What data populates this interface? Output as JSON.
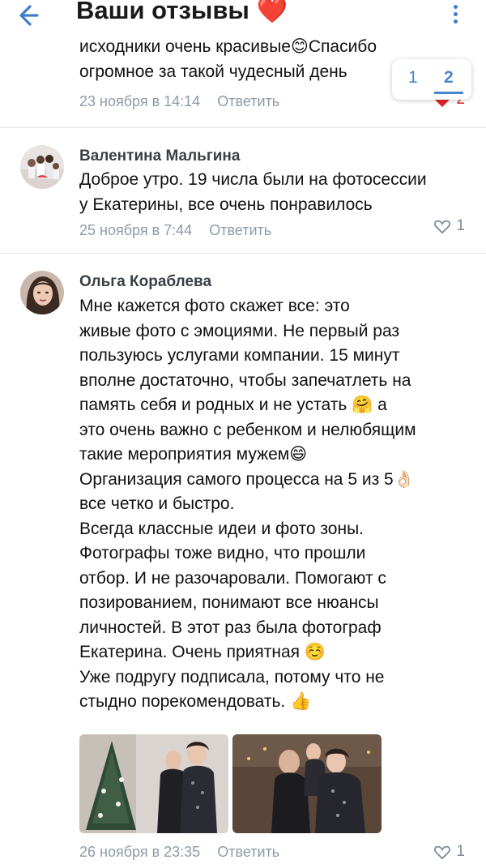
{
  "header": {
    "title": "Ваши отзывы",
    "title_emoji": "❤️"
  },
  "pager": {
    "pages": [
      "1",
      "2"
    ],
    "active": "2"
  },
  "comments": [
    {
      "lines": [
        "исходники  очень красивые😊Спасибо",
        "огромное за такой чудесный день"
      ],
      "date": "23 ноября в 14:14",
      "reply": "Ответить",
      "likes": "2"
    },
    {
      "author": "Валентина Мальгина",
      "lines": [
        "Доброе утро. 19 числа были на фотосессии",
        "у Екатерины, все очень понравилось"
      ],
      "date": "25 ноября в 7:44",
      "reply": "Ответить",
      "likes": "1"
    },
    {
      "author": "Ольга Кораблева",
      "lines": [
        "Мне кажется фото скажет все: это",
        "живые фото с эмоциями. Не первый раз",
        "пользуюсь услугами компании. 15 минут",
        "вполне достаточно, чтобы запечатлеть на",
        "память себя и родных и не устать 🤗 а",
        "это очень важно с ребенком и нелюбящим",
        "такие мероприятия мужем😄",
        "Организация самого процесса на 5 из 5👌🏻",
        "все четко и быстро.",
        "Всегда классные идеи и фото зоны.",
        "Фотографы тоже видно, что прошли",
        "отбор.  И не разочаровали. Помогают с",
        "позированием, понимают все нюансы",
        "личностей. В этот раз была фотограф",
        "Екатерина. Очень приятная ☺️",
        "Уже подругу подписала, потому что не",
        "стыдно порекомендовать. 👍"
      ],
      "date": "26 ноября в 23:35",
      "reply": "Ответить",
      "likes": "1"
    }
  ],
  "colors": {
    "accent": "#4986cc",
    "meta": "#8e9aa8",
    "like_active": "#e0242b",
    "separator": "#e4e6ea"
  }
}
